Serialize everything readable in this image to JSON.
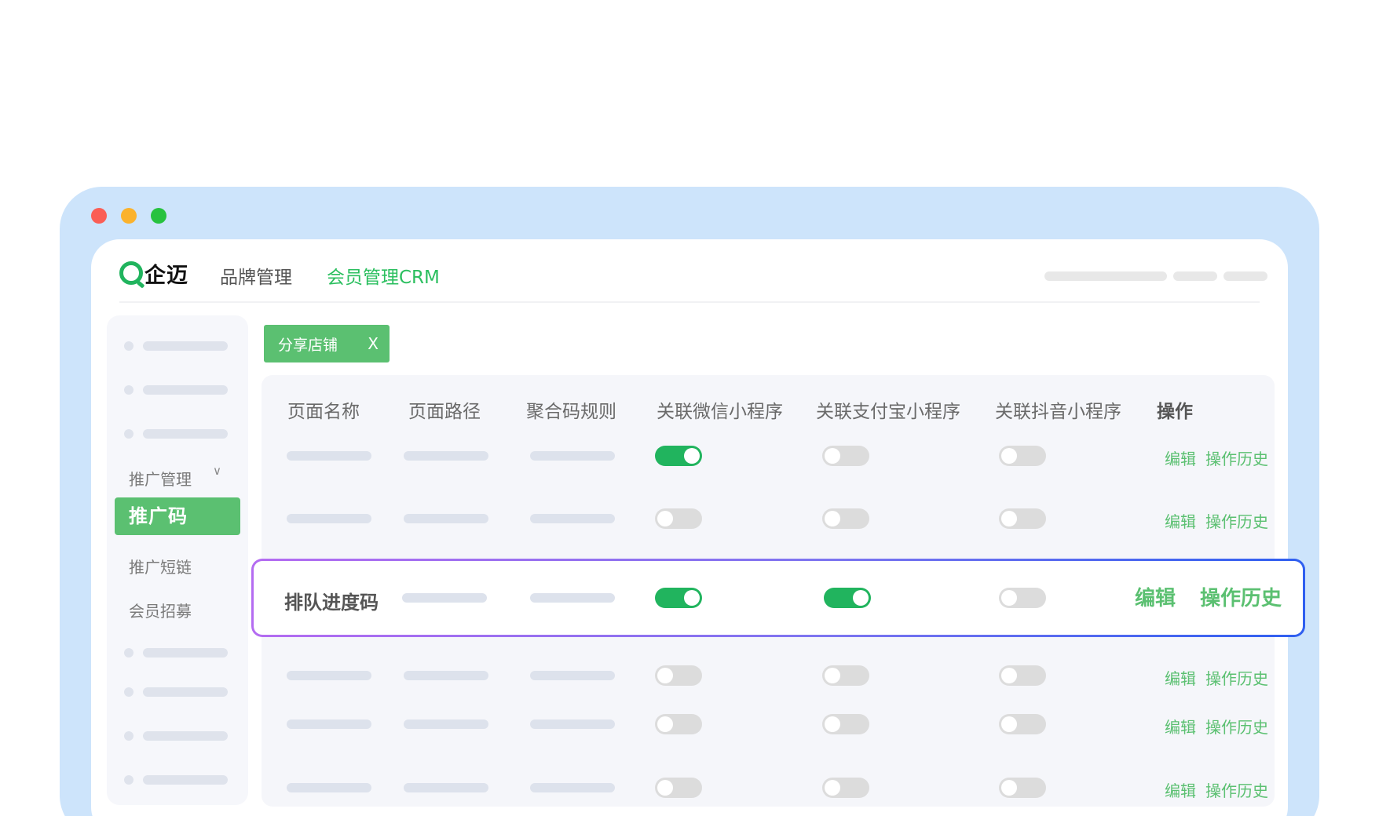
{
  "window": {
    "controls": [
      "close",
      "minimize",
      "maximize"
    ],
    "colors": {
      "close": "#fa5e55",
      "minimize": "#fbb22c",
      "maximize": "#27c23f",
      "frame": "#cde4fb"
    }
  },
  "header": {
    "logo_text": "企迈",
    "nav": [
      {
        "label": "品牌管理",
        "active": false
      },
      {
        "label": "会员管理CRM",
        "active": true
      }
    ]
  },
  "sidebar": {
    "group_label": "推广管理",
    "items": [
      {
        "label": "推广码",
        "active": true
      },
      {
        "label": "推广短链",
        "active": false
      },
      {
        "label": "会员招募",
        "active": false
      }
    ]
  },
  "tag": {
    "label": "分享店铺",
    "close_label": "X"
  },
  "table": {
    "columns": [
      "页面名称",
      "页面路径",
      "聚合码规则",
      "关联微信小程序",
      "关联支付宝小程序",
      "关联抖音小程序",
      "操作"
    ],
    "action_edit": "编辑",
    "action_history": "操作历史",
    "rows": [
      {
        "name": "",
        "wechat": true,
        "alipay": false,
        "douyin": false,
        "highlighted": false
      },
      {
        "name": "",
        "wechat": false,
        "alipay": false,
        "douyin": false,
        "highlighted": false
      },
      {
        "name": "排队进度码",
        "wechat": true,
        "alipay": true,
        "douyin": false,
        "highlighted": true
      },
      {
        "name": "",
        "wechat": false,
        "alipay": false,
        "douyin": false,
        "highlighted": false
      },
      {
        "name": "",
        "wechat": false,
        "alipay": false,
        "douyin": false,
        "highlighted": false
      },
      {
        "name": "",
        "wechat": false,
        "alipay": false,
        "douyin": false,
        "highlighted": false
      }
    ]
  },
  "accent_color": "#21b45e"
}
